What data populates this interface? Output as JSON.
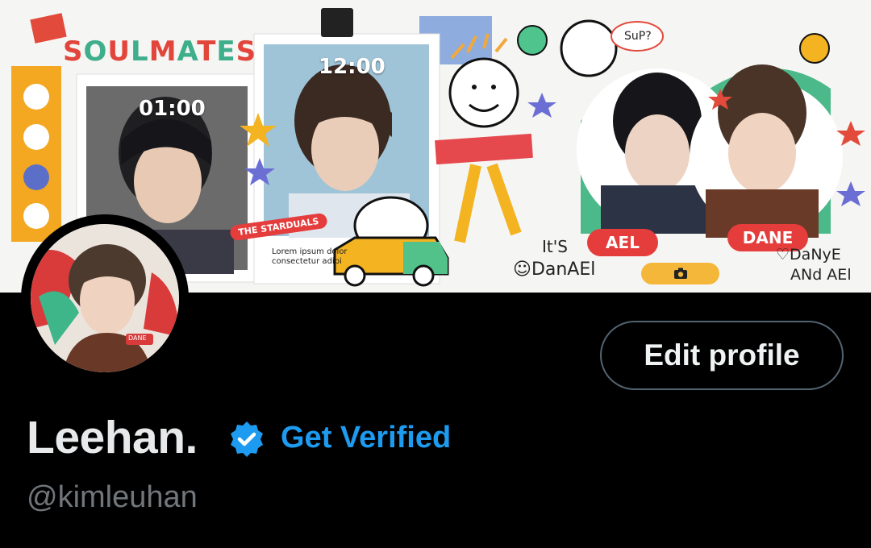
{
  "profile": {
    "display_name": "Leehan.",
    "handle": "@kimleuhan",
    "get_verified_label": "Get Verified",
    "edit_profile_label": "Edit profile"
  },
  "banner": {
    "title": "SOULMATES",
    "clock_left": "01:00",
    "clock_center": "12:00",
    "sticker_stardust": "THE STARDUALS",
    "lorem_line1": "Lorem ipsum dolor",
    "lorem_line2": "consectetur adipi",
    "speech_bubble": "SuP?",
    "its": "It'S",
    "danael": "DanAEl",
    "label_ael": "AEL",
    "label_dane": "DANE",
    "danye_line1": "DaNyE",
    "danye_line2": "ANd AEl"
  },
  "avatar": {
    "tag": "DANE"
  },
  "icons": {
    "camera": "camera-icon",
    "verified": "verified-badge-icon"
  },
  "colors": {
    "background": "#000000",
    "accent_blue": "#1d9bf0",
    "handle_gray": "#71767b",
    "button_border": "#536471"
  }
}
